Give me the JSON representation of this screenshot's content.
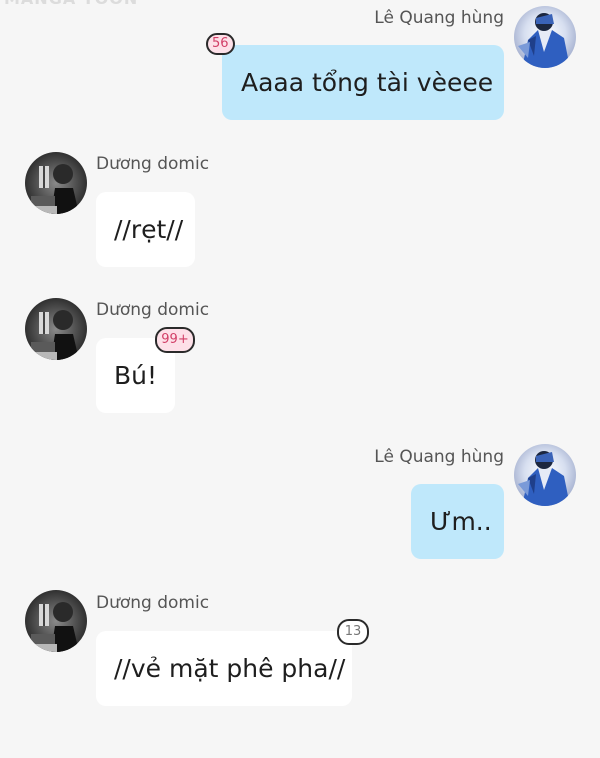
{
  "app": {
    "watermark": "MANGA TOON"
  },
  "users": {
    "right_name": "Lê Quang hùng",
    "left_name": "Dương domic"
  },
  "messages": [
    {
      "side": "right",
      "sender": "Lê Quang hùng",
      "text": "Aaaa tổng tài vèeee",
      "badge": "56"
    },
    {
      "side": "left",
      "sender": "Dương domic",
      "text": "//rẹt//",
      "badge": ""
    },
    {
      "side": "left",
      "sender": "Dương domic",
      "text": "Bú!",
      "badge": "99+"
    },
    {
      "side": "right",
      "sender": "Lê Quang hùng",
      "text": "Ưm..",
      "badge": ""
    },
    {
      "side": "left",
      "sender": "Dương domic",
      "text": "//vẻ mặt phê pha//",
      "badge": "13"
    }
  ],
  "colors": {
    "background": "#f6f6f6",
    "left_bubble": "#ffffff",
    "right_bubble": "#bfe8fb",
    "badge_pink": "#fde0e8",
    "badge_pink_text": "#d23f67",
    "badge_grey": "#ffffff"
  },
  "icons": {
    "right_avatar": "avatar-blue-jacket",
    "left_avatar": "avatar-dark-photo"
  }
}
